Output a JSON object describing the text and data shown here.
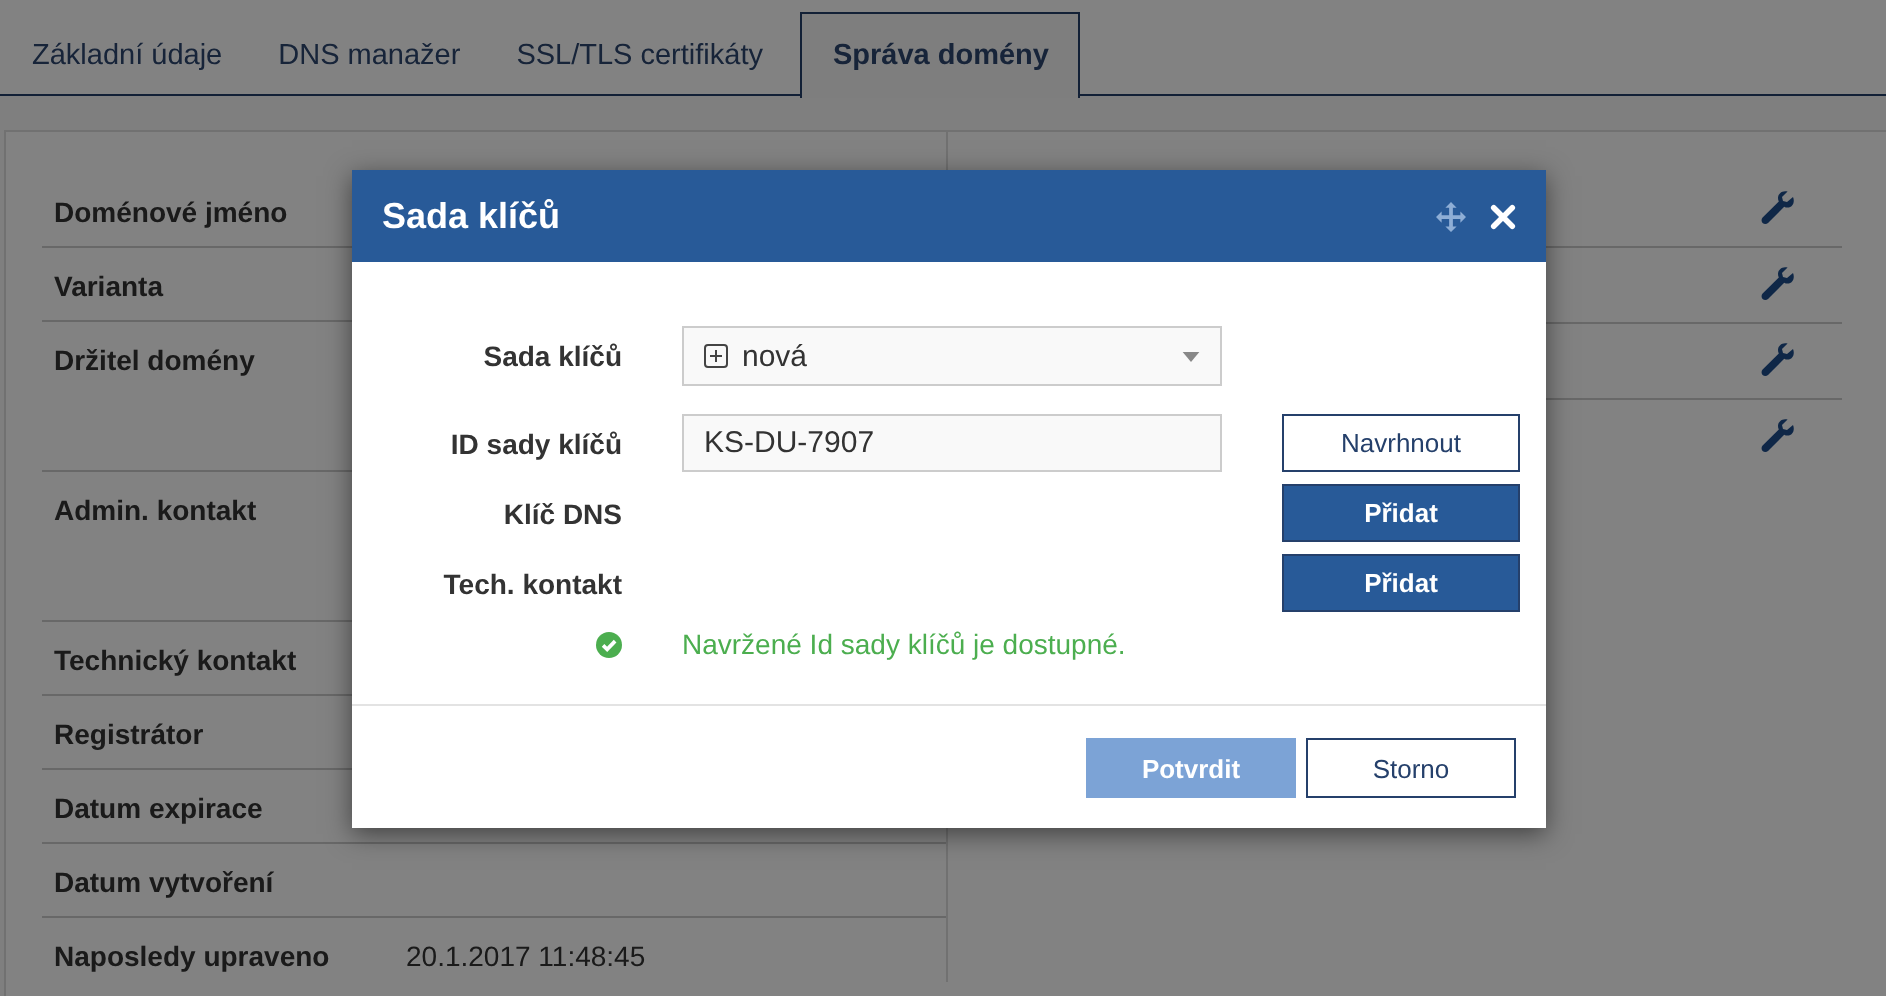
{
  "tabs": [
    {
      "label": "Základní údaje",
      "selected": false
    },
    {
      "label": "DNS manažer",
      "selected": false
    },
    {
      "label": "SSL/TLS certifikáty",
      "selected": false
    },
    {
      "label": "Správa domény",
      "selected": true
    }
  ],
  "details": {
    "rows": [
      {
        "label": "Doménové jméno",
        "tall": false
      },
      {
        "label": "Varianta",
        "tall": false
      },
      {
        "label": "Držitel domény",
        "tall": true
      },
      {
        "label": "Admin. kontakt",
        "tall": true
      },
      {
        "label": "Technický kontakt",
        "tall": false
      },
      {
        "label": "Registrátor",
        "tall": false
      },
      {
        "label": "Datum expirace",
        "tall": false
      },
      {
        "label": "Datum vytvoření",
        "tall": false
      },
      {
        "label": "Naposledy upraveno",
        "tall": false,
        "value": "20.1.2017 11:48:45"
      }
    ]
  },
  "dialog": {
    "title": "Sada klíčů",
    "fields": [
      {
        "label": "Sada klíčů",
        "kind": "select",
        "value": "nová"
      },
      {
        "label": "ID sady klíčů",
        "kind": "input",
        "value": "KS-DU-7907",
        "button": {
          "label": "Navrhnout",
          "kind": "outline"
        }
      },
      {
        "label": "Klíč DNS",
        "kind": "none",
        "button": {
          "label": "Přidat",
          "kind": "primary"
        }
      },
      {
        "label": "Tech. kontakt",
        "kind": "none",
        "button": {
          "label": "Přidat",
          "kind": "primary"
        }
      }
    ],
    "message": {
      "kind": "success",
      "text": "Navržené Id sady klíčů je dostupné."
    },
    "buttons": [
      {
        "label": "Potvrdit",
        "kind": "primary",
        "disabled": true
      },
      {
        "label": "Storno",
        "kind": "outline",
        "disabled": false
      }
    ]
  }
}
